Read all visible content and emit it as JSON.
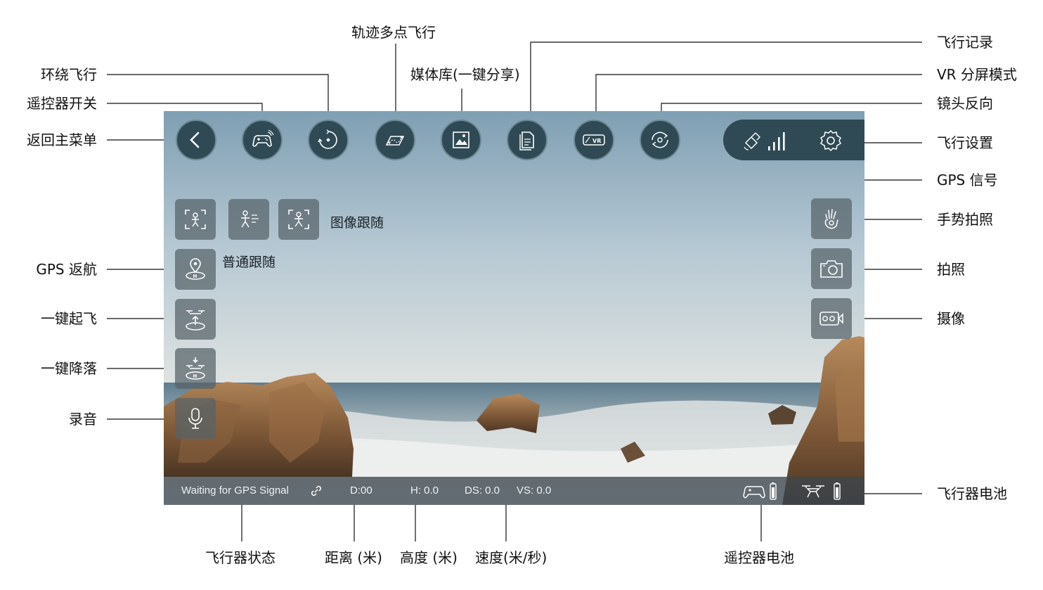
{
  "labels": {
    "back_to_menu": "返回主菜单",
    "rc_switch": "遥控器开关",
    "orbit_flight": "环绕飞行",
    "waypoint_flight": "轨迹多点飞行",
    "media_library": "媒体库(一键分享)",
    "flight_log": "飞行记录",
    "vr_mode": "VR 分屏模式",
    "lens_flip": "镜头反向",
    "flight_settings": "飞行设置",
    "gps_signal": "GPS 信号",
    "gesture_photo": "手势拍照",
    "photo": "拍照",
    "video": "摄像",
    "gps_return": "GPS 返航",
    "takeoff": "一键起飞",
    "landing": "一键降落",
    "record_audio": "录音",
    "aircraft_battery": "飞行器电池",
    "aircraft_status": "飞行器状态",
    "distance": "距离 (米)",
    "height": "高度 (米)",
    "speed": "速度(米/秒)",
    "rc_battery": "遥控器电池"
  },
  "screen": {
    "image_follow_label": "图像跟随",
    "normal_follow_label": "普通跟随",
    "status": {
      "gps_text": "Waiting for GPS Signal",
      "distance": "D:00",
      "height": "H: 0.0",
      "ds": "DS: 0.0",
      "vs": "VS: 0.0"
    }
  },
  "icons": {
    "top": [
      "back-icon",
      "gamepad-icon",
      "orbit-icon",
      "waypoint-icon",
      "gallery-icon",
      "document-icon",
      "vr-icon",
      "camera-flip-icon"
    ],
    "left": [
      "face-track-icon",
      "run-follow-icon",
      "image-follow-icon",
      "gps-return-icon",
      "takeoff-icon",
      "landing-icon",
      "mic-icon"
    ],
    "right": [
      "gesture-icon",
      "camera-icon",
      "video-icon"
    ],
    "status": [
      "link-icon",
      "controller-battery-icon",
      "drone-battery-icon"
    ],
    "pill": [
      "satellite-icon",
      "signal-bars-icon",
      "gear-icon"
    ]
  },
  "colors": {
    "button_bg": "#2f4a55",
    "sky_top": "#7f9fb3",
    "sky_bottom": "#dfe3e1",
    "status_bar": "#3c464e"
  }
}
